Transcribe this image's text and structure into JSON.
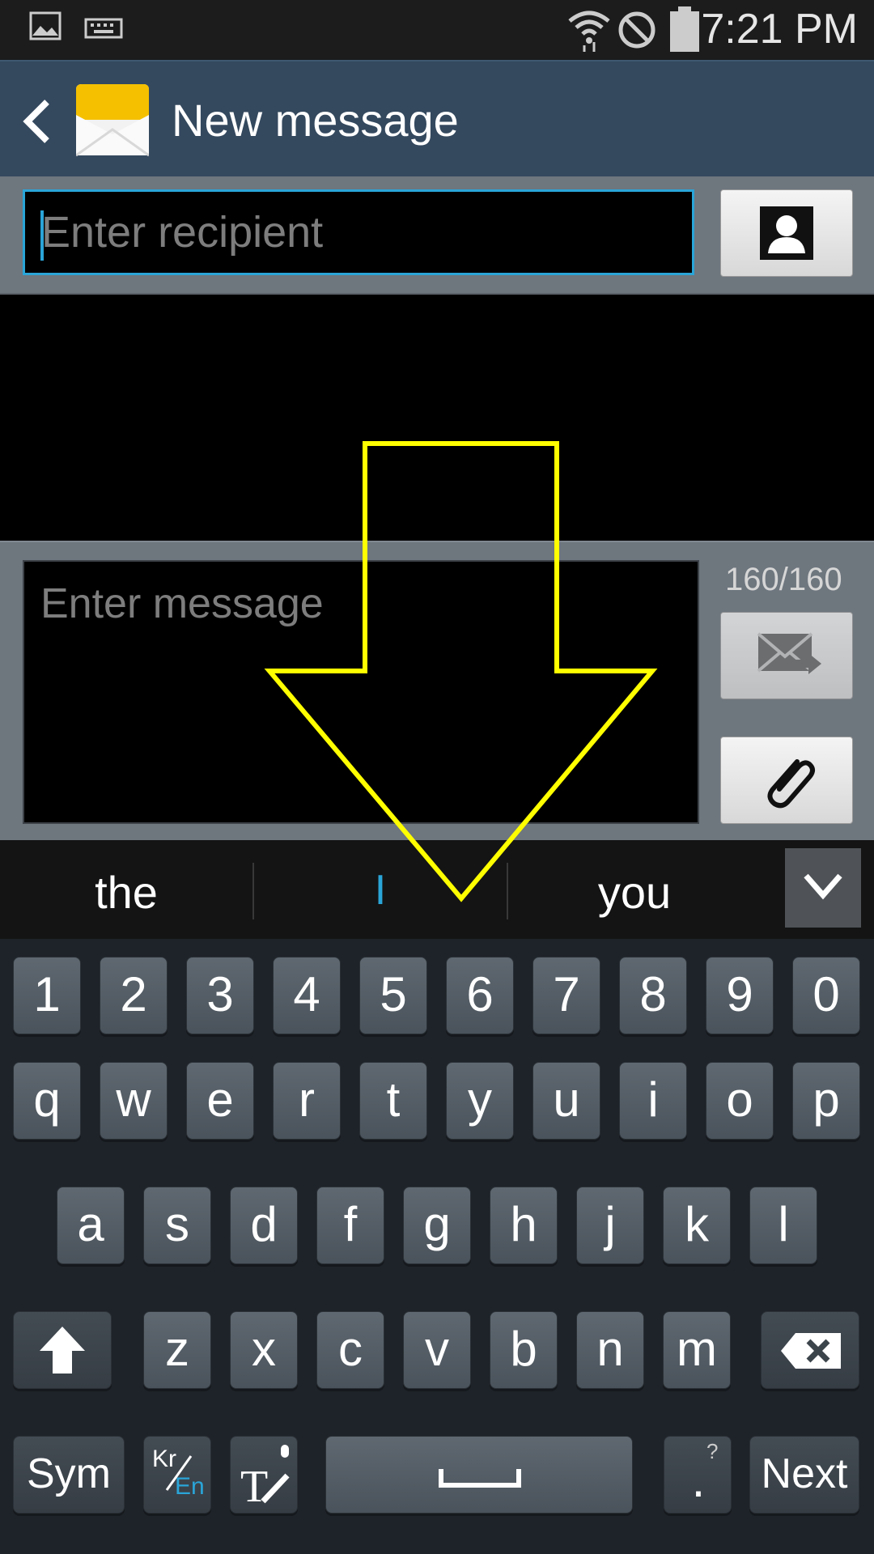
{
  "status_bar": {
    "time": "7:21 PM",
    "icons": [
      "image-icon",
      "keyboard-icon",
      "wifi-icon",
      "do-not-disturb-icon",
      "battery-icon"
    ]
  },
  "action_bar": {
    "title": "New message",
    "back_icon": "back-icon",
    "app_icon": "envelope-icon"
  },
  "recipient": {
    "placeholder": "Enter recipient",
    "value": "",
    "contacts_button_icon": "contact-icon"
  },
  "compose": {
    "placeholder": "Enter message",
    "value": "",
    "counter": "160/160",
    "send_icon": "send-icon",
    "attach_icon": "paperclip-icon"
  },
  "suggestions": {
    "items": [
      "the",
      "I",
      "you"
    ],
    "collapse_icon": "chevron-down-icon"
  },
  "keyboard": {
    "row_numbers": [
      "1",
      "2",
      "3",
      "4",
      "5",
      "6",
      "7",
      "8",
      "9",
      "0"
    ],
    "row_top": [
      "q",
      "w",
      "e",
      "r",
      "t",
      "y",
      "u",
      "i",
      "o",
      "p"
    ],
    "row_home": [
      "a",
      "s",
      "d",
      "f",
      "g",
      "h",
      "j",
      "k",
      "l"
    ],
    "row_bottom": [
      "z",
      "x",
      "c",
      "v",
      "b",
      "n",
      "m"
    ],
    "sym_label": "Sym",
    "lang_primary": "Kr",
    "lang_secondary": "En",
    "next_label": "Next",
    "period_label": ".",
    "period_alt": "?"
  },
  "colors": {
    "accent": "#2aa5d8",
    "action_bar": "#34495e",
    "overlay_arrow": "#ffff00"
  },
  "overlay": {
    "icon": "arrow-down-icon"
  }
}
